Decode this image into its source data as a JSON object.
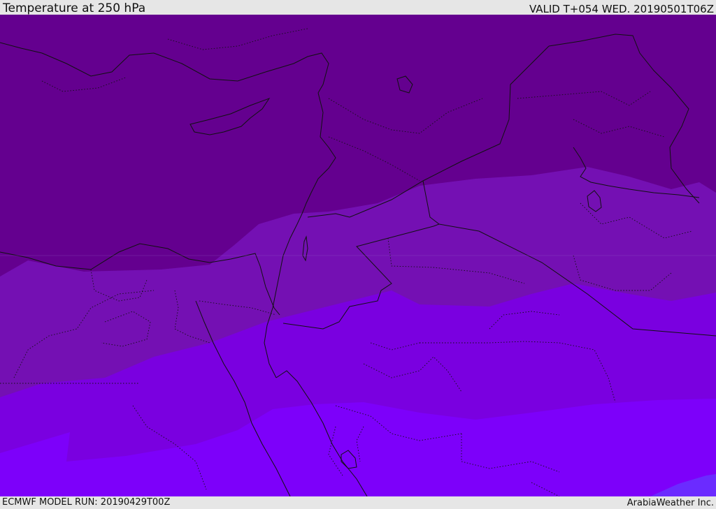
{
  "header": {
    "title": "Temperature at 250 hPa",
    "valid": "VALID T+054 WED. 20190501T06Z"
  },
  "footer": {
    "model_run": "ECMWF MODEL RUN: 20190429T00Z",
    "credit": "ArabiaWeather Inc."
  },
  "map": {
    "fill_colors": {
      "band_1": "#64008f",
      "band_2": "#7410b3",
      "band_3": "#7a00e0",
      "band_4": "#7d00fa",
      "band_5": "#6b2bff"
    },
    "line_color": "#111111"
  }
}
